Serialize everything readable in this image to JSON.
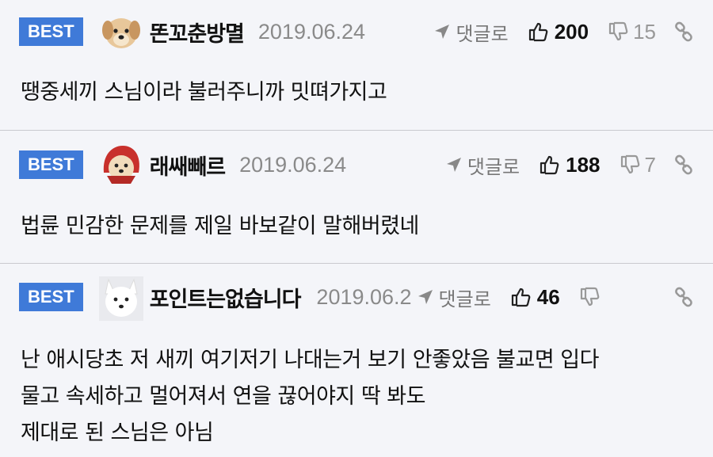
{
  "comments": [
    {
      "badge": "BEST",
      "avatar_icon": "puppy-avatar-icon",
      "nickname": "똔꼬춘방멸",
      "date": "2019.06.24",
      "reply_label": "댓글로",
      "likes": "200",
      "dislikes": "15",
      "lines": [
        "땡중세끼 스님이라 불러주니까 밋뗘가지고"
      ]
    },
    {
      "badge": "BEST",
      "avatar_icon": "puppy-red-hood-avatar-icon",
      "nickname": "래쌔빼르",
      "date": "2019.06.24",
      "reply_label": "댓글로",
      "likes": "188",
      "dislikes": "7",
      "lines": [
        "법륜 민감한 문제를 제일 바보같이 말해버렸네"
      ]
    },
    {
      "badge": "BEST",
      "avatar_icon": "white-fox-avatar-icon",
      "nickname": "포인트는없습니다",
      "date": "2019.06.2",
      "reply_label": "댓글로",
      "likes": "46",
      "dislikes": "",
      "lines": [
        "난 애시당초 저 새끼 여기저기 나대는거 보기 안좋았음 불교면 입다",
        "물고 속세하고 멀어져서 연을 끊어야지 딱 봐도",
        "제대로 된 스님은 아님"
      ]
    }
  ],
  "colors": {
    "badge": "#3f7ad8",
    "background": "#f4f5f9",
    "divider": "#c9c9cf",
    "meta_gray": "#8a8a8a"
  }
}
